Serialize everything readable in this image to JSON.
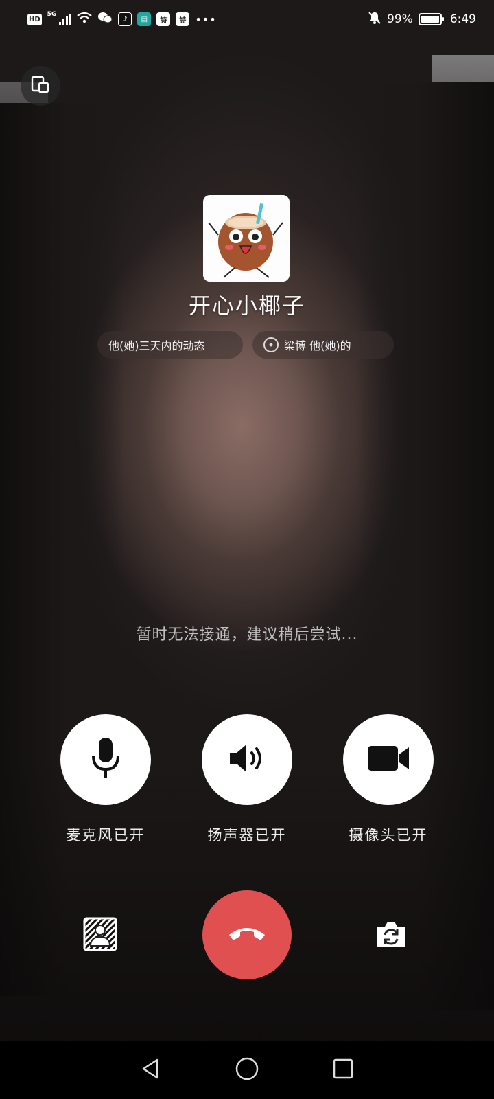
{
  "status_bar": {
    "hd": "HD",
    "network": "5G",
    "battery": "99%",
    "time": "6:49",
    "app_icons": [
      "wechat-icon",
      "tiktok-icon",
      "reader-icon",
      "app-icon",
      "app-icon"
    ]
  },
  "caller": {
    "name": "开心小椰子",
    "chip_moments": "他(她)三天内的动态",
    "chip_mutual": "梁博 他(她)的"
  },
  "call_status": "暂时无法接通，建议稍后尝试...",
  "controls": {
    "mic_label": "麦克风已开",
    "speaker_label": "扬声器已开",
    "camera_label": "摄像头已开"
  },
  "colors": {
    "hangup": "#e05050",
    "button_bg": "#ffffff"
  }
}
